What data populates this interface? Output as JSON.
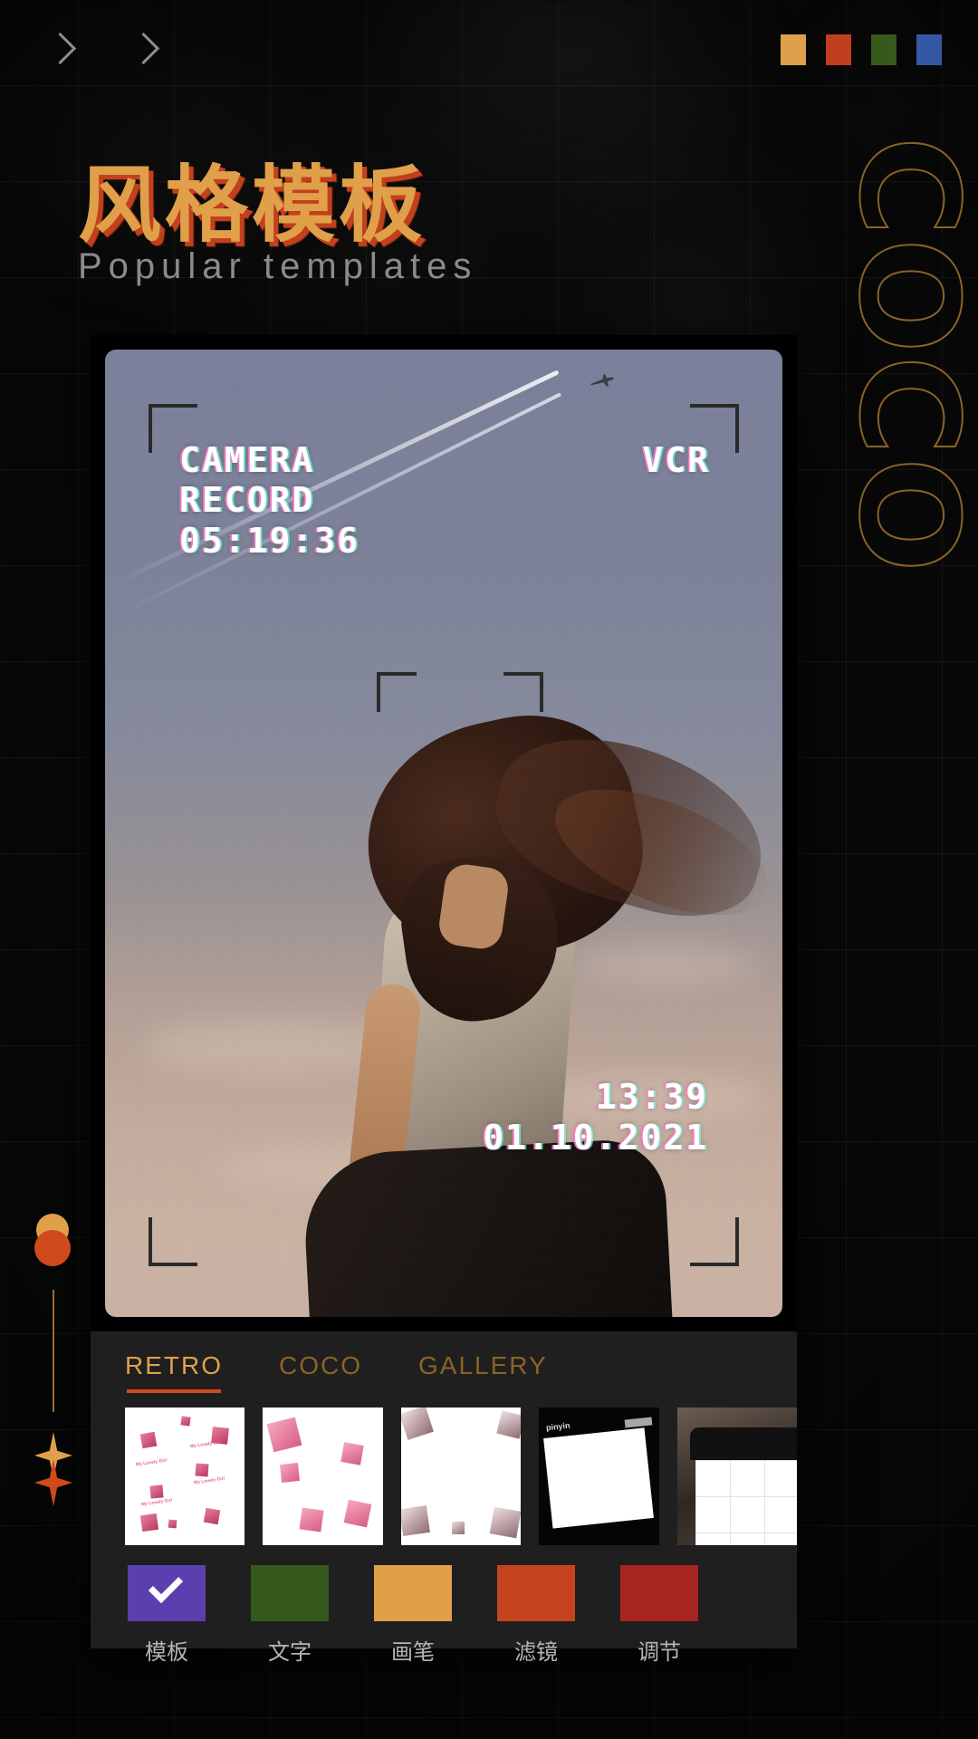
{
  "header": {
    "back_icon": "chevron-right-icon",
    "forward_icon": "chevron-right-icon",
    "swatches": [
      {
        "name": "swatch-amber",
        "color": "#dfa04c"
      },
      {
        "name": "swatch-red",
        "color": "#c03f20"
      },
      {
        "name": "swatch-green",
        "color": "#37591c"
      },
      {
        "name": "swatch-blue",
        "color": "#3558a6"
      }
    ]
  },
  "heading": {
    "title_cn": "风格模板",
    "subtitle_en": "Popular templates",
    "title_color": "#e0a04a",
    "title_shadow_color": "#c2401c",
    "subtitle_color": "#8b8b8b"
  },
  "side_decor": {
    "letters": [
      "C",
      "O",
      "C",
      "O"
    ],
    "stroke_color": "#8a6328"
  },
  "rail": {
    "dot_top_color": "#e0a04a",
    "dot_bottom_color": "#cf4a1c",
    "line_color": "#9a6f2c",
    "spark_top_color": "#e0a04a",
    "spark_bottom_color": "#cf4a1c"
  },
  "preview": {
    "overlay": {
      "label_camera": "CAMERA",
      "label_record": "RECORD",
      "timecode": "05:19:36",
      "label_vcr": "VCR",
      "clock": "13:39",
      "date": "01.10.2021"
    }
  },
  "panel": {
    "tabs": [
      {
        "label": "RETRO",
        "active": true
      },
      {
        "label": "COCO",
        "active": false
      },
      {
        "label": "GALLERY",
        "active": false
      }
    ],
    "tab_active_color": "#e0a04a",
    "tab_inactive_color": "#8a6328",
    "tab_underline_color": "#cf4a1c",
    "thumbnails": [
      {
        "name": "template-hearts-text",
        "kind": "hearts-text"
      },
      {
        "name": "template-hearts-3d",
        "kind": "hearts-3d"
      },
      {
        "name": "template-pearl-hearts",
        "kind": "pearl-hearts"
      },
      {
        "name": "template-phone-black",
        "kind": "phone-black",
        "caption": "pinyin"
      },
      {
        "name": "template-phone-screen",
        "kind": "phone-screen"
      }
    ],
    "tools": [
      {
        "label": "模板",
        "color": "#5c3fae",
        "selected": true,
        "icon": "check-icon"
      },
      {
        "label": "文字",
        "color": "#37591c",
        "selected": false,
        "icon": ""
      },
      {
        "label": "画笔",
        "color": "#e0a04a",
        "selected": false,
        "icon": ""
      },
      {
        "label": "滤镜",
        "color": "#c5441e",
        "selected": false,
        "icon": ""
      },
      {
        "label": "调节",
        "color": "#a82420",
        "selected": false,
        "icon": ""
      }
    ]
  }
}
